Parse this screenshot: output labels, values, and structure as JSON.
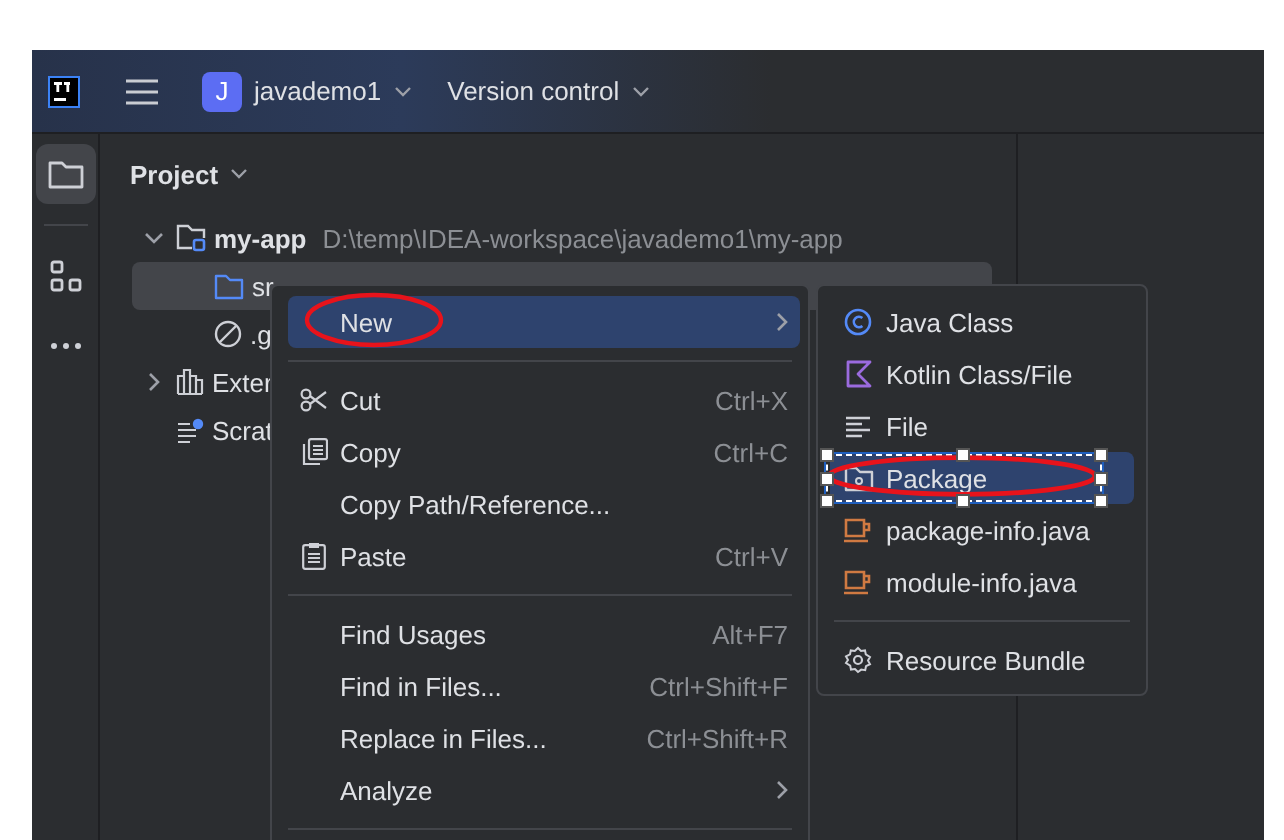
{
  "title_bar": {
    "project_initial": "J",
    "project_name": "javademo1",
    "vcs_label": "Version control"
  },
  "tool_strip": [
    {
      "kind": "project",
      "selected": true
    },
    {
      "kind": "structure",
      "selected": false
    },
    {
      "kind": "more",
      "selected": false
    }
  ],
  "project_panel": {
    "title": "Project",
    "tree": [
      {
        "name": "my-app",
        "path": "D:\\temp\\IDEA-workspace\\javademo1\\my-app",
        "kind": "module",
        "expanded": true,
        "selected": false,
        "children": [
          {
            "name": "sr",
            "kind": "folder",
            "selected": true
          },
          {
            "name": ".g",
            "kind": "ignored",
            "selected": false
          }
        ]
      },
      {
        "name": "Exter",
        "kind": "libraries",
        "expanded": false,
        "selected": false
      },
      {
        "name": "Scrat",
        "kind": "scratches",
        "selected": false
      }
    ]
  },
  "context_menu": [
    {
      "kind": "submenu",
      "label": "New",
      "selected": true,
      "circled": true
    },
    {
      "kind": "separator"
    },
    {
      "kind": "cut",
      "label": "Cut",
      "shortcut": "Ctrl+X",
      "selected": false
    },
    {
      "kind": "copy",
      "label": "Copy",
      "shortcut": "Ctrl+C",
      "selected": false
    },
    {
      "kind": "plain",
      "label": "Copy Path/Reference...",
      "selected": false
    },
    {
      "kind": "paste",
      "label": "Paste",
      "shortcut": "Ctrl+V",
      "selected": false
    },
    {
      "kind": "separator"
    },
    {
      "kind": "plain",
      "label": "Find Usages",
      "shortcut": "Alt+F7",
      "selected": false
    },
    {
      "kind": "plain",
      "label": "Find in Files...",
      "shortcut": "Ctrl+Shift+F",
      "selected": false
    },
    {
      "kind": "plain",
      "label": "Replace in Files...",
      "shortcut": "Ctrl+Shift+R",
      "selected": false
    },
    {
      "kind": "submenu",
      "label": "Analyze",
      "selected": false
    },
    {
      "kind": "separator"
    }
  ],
  "new_submenu": [
    {
      "kind": "java-class",
      "label": "Java Class",
      "selected": false
    },
    {
      "kind": "kotlin",
      "label": "Kotlin Class/File",
      "selected": false
    },
    {
      "kind": "file",
      "label": "File",
      "selected": false
    },
    {
      "kind": "package",
      "label": "Package",
      "selected": true,
      "circled": true
    },
    {
      "kind": "java-file",
      "label": "package-info.java",
      "selected": false
    },
    {
      "kind": "java-file",
      "label": "module-info.java",
      "selected": false
    },
    {
      "kind": "separator"
    },
    {
      "kind": "bundle",
      "label": "Resource Bundle",
      "selected": false
    }
  ]
}
